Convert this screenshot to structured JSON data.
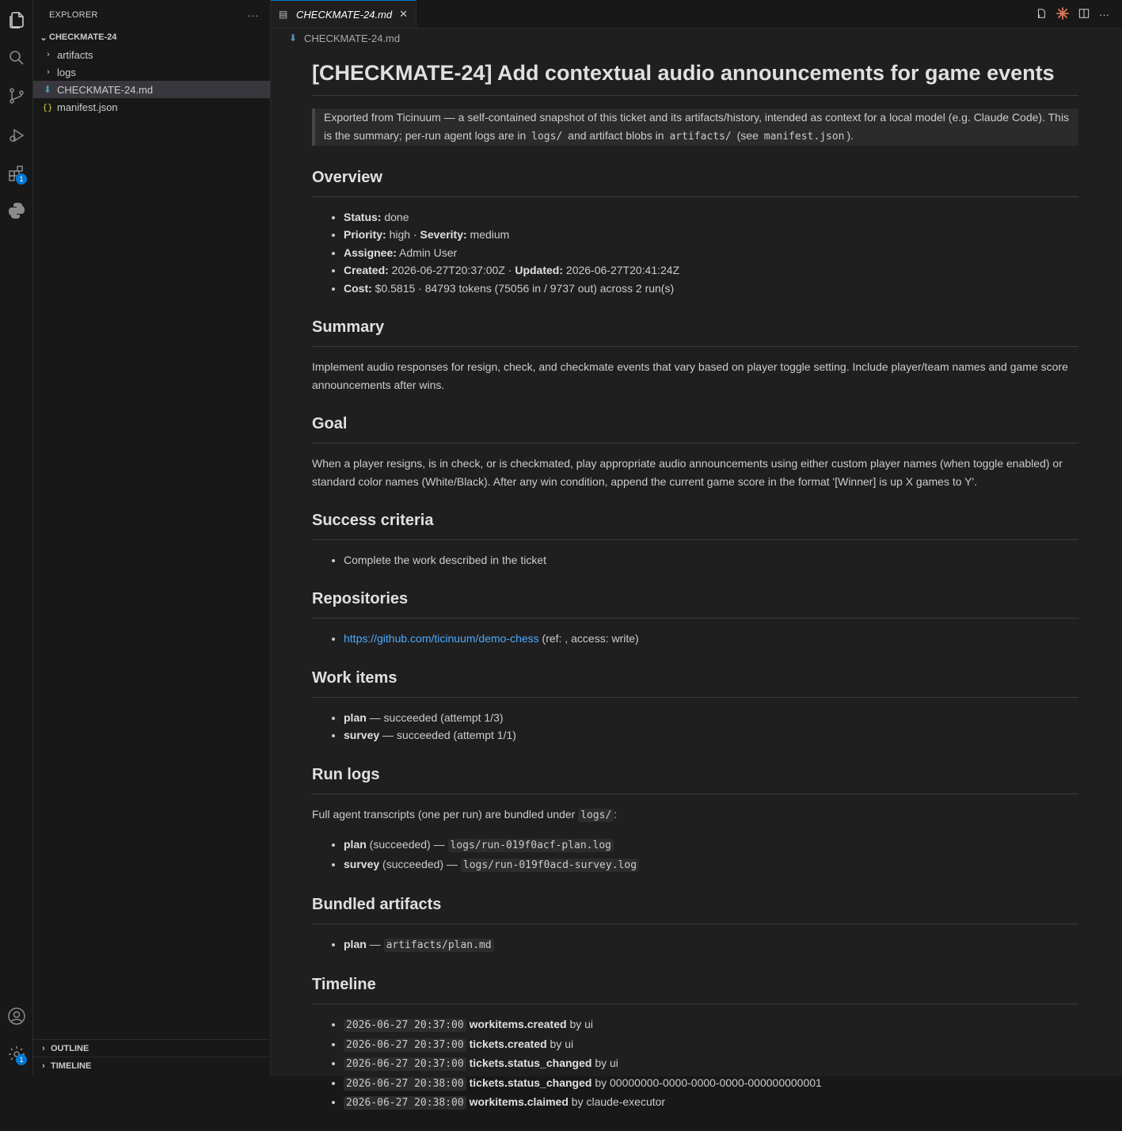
{
  "activity": {
    "extensions_badge": "1",
    "settings_badge": "1"
  },
  "sidebar": {
    "title": "EXPLORER",
    "more": "···",
    "root": "CHECKMATE-24",
    "items": [
      {
        "label": "artifacts"
      },
      {
        "label": "logs"
      },
      {
        "label": "CHECKMATE-24.md"
      },
      {
        "label": "manifest.json"
      }
    ],
    "outline": "OUTLINE",
    "timeline": "TIMELINE"
  },
  "editor": {
    "tab_label": "CHECKMATE-24.md",
    "tab_close": "✕",
    "breadcrumb": "CHECKMATE-24.md"
  },
  "doc": {
    "title": "[CHECKMATE-24] Add contextual audio announcements for game events",
    "note": {
      "t1": "Exported from Ticinuum — a self-contained snapshot of this ticket and its artifacts/history, intended as context for a local model (e.g. Claude Code). This is the summary; per-run agent logs are in ",
      "c1": "logs/",
      "t2": " and artifact blobs in ",
      "c2": "artifacts/",
      "t3": " (see ",
      "c3": "manifest.json",
      "t4": ")."
    },
    "overview": {
      "heading": "Overview",
      "status_label": "Status:",
      "status": " done",
      "priority_label": "Priority:",
      "priority": " high · ",
      "severity_label": "Severity:",
      "severity": " medium",
      "assignee_label": "Assignee:",
      "assignee": " Admin User",
      "created_label": "Created:",
      "created": " 2026-06-27T20:37:00Z · ",
      "updated_label": "Updated:",
      "updated": " 2026-06-27T20:41:24Z",
      "cost_label": "Cost:",
      "cost": " $0.5815 · 84793 tokens (75056 in / 9737 out) across 2 run(s)"
    },
    "summary": {
      "heading": "Summary",
      "text": "Implement audio responses for resign, check, and checkmate events that vary based on player toggle setting. Include player/team names and game score announcements after wins."
    },
    "goal": {
      "heading": "Goal",
      "text": "When a player resigns, is in check, or is checkmated, play appropriate audio announcements using either custom player names (when toggle enabled) or standard color names (White/Black). After any win condition, append the current game score in the format '[Winner] is up X games to Y'."
    },
    "success": {
      "heading": "Success criteria",
      "item": "Complete the work described in the ticket"
    },
    "repos": {
      "heading": "Repositories",
      "url": "https://github.com/ticinuum/demo-chess",
      "meta": " (ref: , access: write)"
    },
    "work": {
      "heading": "Work items",
      "items": [
        {
          "name": "plan",
          "rest": " — succeeded (attempt 1/3)"
        },
        {
          "name": "survey",
          "rest": " — succeeded (attempt 1/1)"
        }
      ]
    },
    "runlogs": {
      "heading": "Run logs",
      "intro": "Full agent transcripts (one per run) are bundled under ",
      "intro_code": "logs/",
      "intro_end": ":",
      "items": [
        {
          "name": "plan",
          "mid": " (succeeded) — ",
          "code": "logs/run-019f0acf-plan.log"
        },
        {
          "name": "survey",
          "mid": " (succeeded) — ",
          "code": "logs/run-019f0acd-survey.log"
        }
      ]
    },
    "bundled": {
      "heading": "Bundled artifacts",
      "name": "plan",
      "mid": " — ",
      "code": "artifacts/plan.md"
    },
    "timeline": {
      "heading": "Timeline",
      "items": [
        {
          "ts": "2026-06-27 20:37:00",
          "event": "workitems.created",
          "by": " by ui"
        },
        {
          "ts": "2026-06-27 20:37:00",
          "event": "tickets.created",
          "by": " by ui"
        },
        {
          "ts": "2026-06-27 20:37:00",
          "event": "tickets.status_changed",
          "by": " by ui"
        },
        {
          "ts": "2026-06-27 20:38:00",
          "event": "tickets.status_changed",
          "by": " by 00000000-0000-0000-0000-000000000001"
        },
        {
          "ts": "2026-06-27 20:38:00",
          "event": "workitems.claimed",
          "by": " by claude-executor"
        }
      ]
    }
  }
}
